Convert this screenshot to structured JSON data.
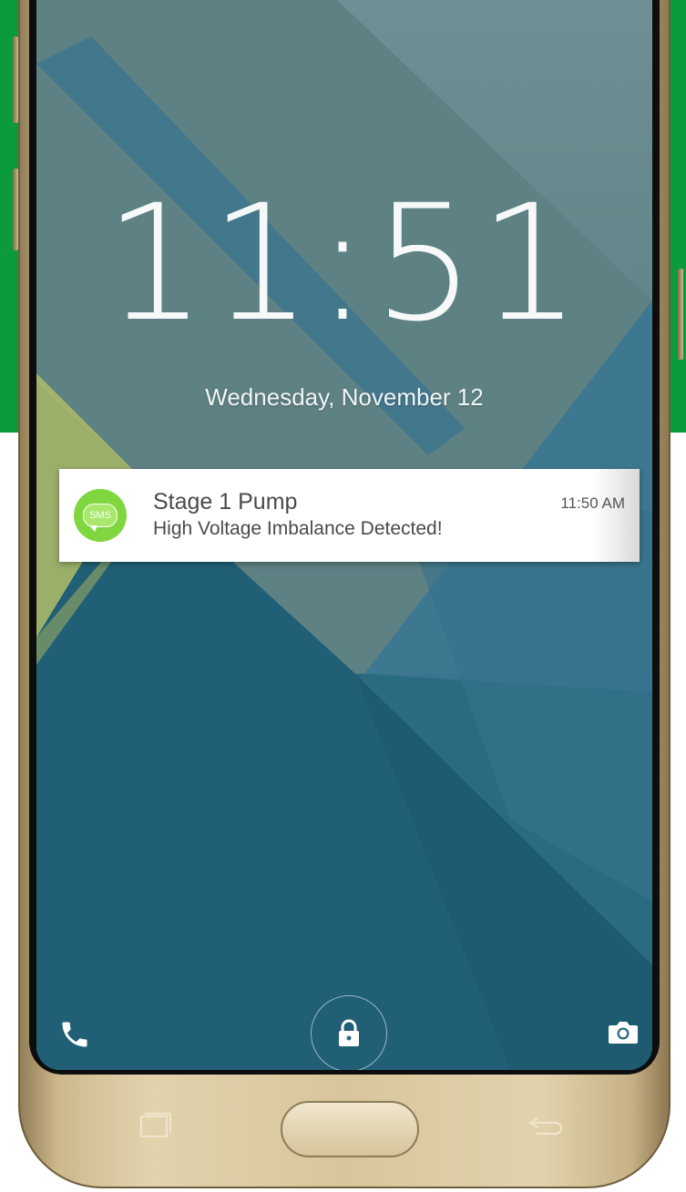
{
  "lock_screen": {
    "time": "11:51",
    "date": "Wednesday, November 12"
  },
  "notification": {
    "app_badge": "SMS",
    "title": "Stage 1 Pump",
    "message": "High Voltage Imbalance Detected!",
    "time": "11:50 AM"
  },
  "shortcuts": {
    "left_icon": "phone-icon",
    "center_icon": "lock-icon",
    "right_icon": "camera-icon"
  },
  "hardware_keys": {
    "left_icon": "recent-apps-icon",
    "right_icon": "back-icon"
  },
  "colors": {
    "brand_green": "#0b9b3a",
    "sms_green": "#7fd63e",
    "gold_frame": "#d8c59b",
    "wallpaper_teal": "#2f6f84"
  }
}
